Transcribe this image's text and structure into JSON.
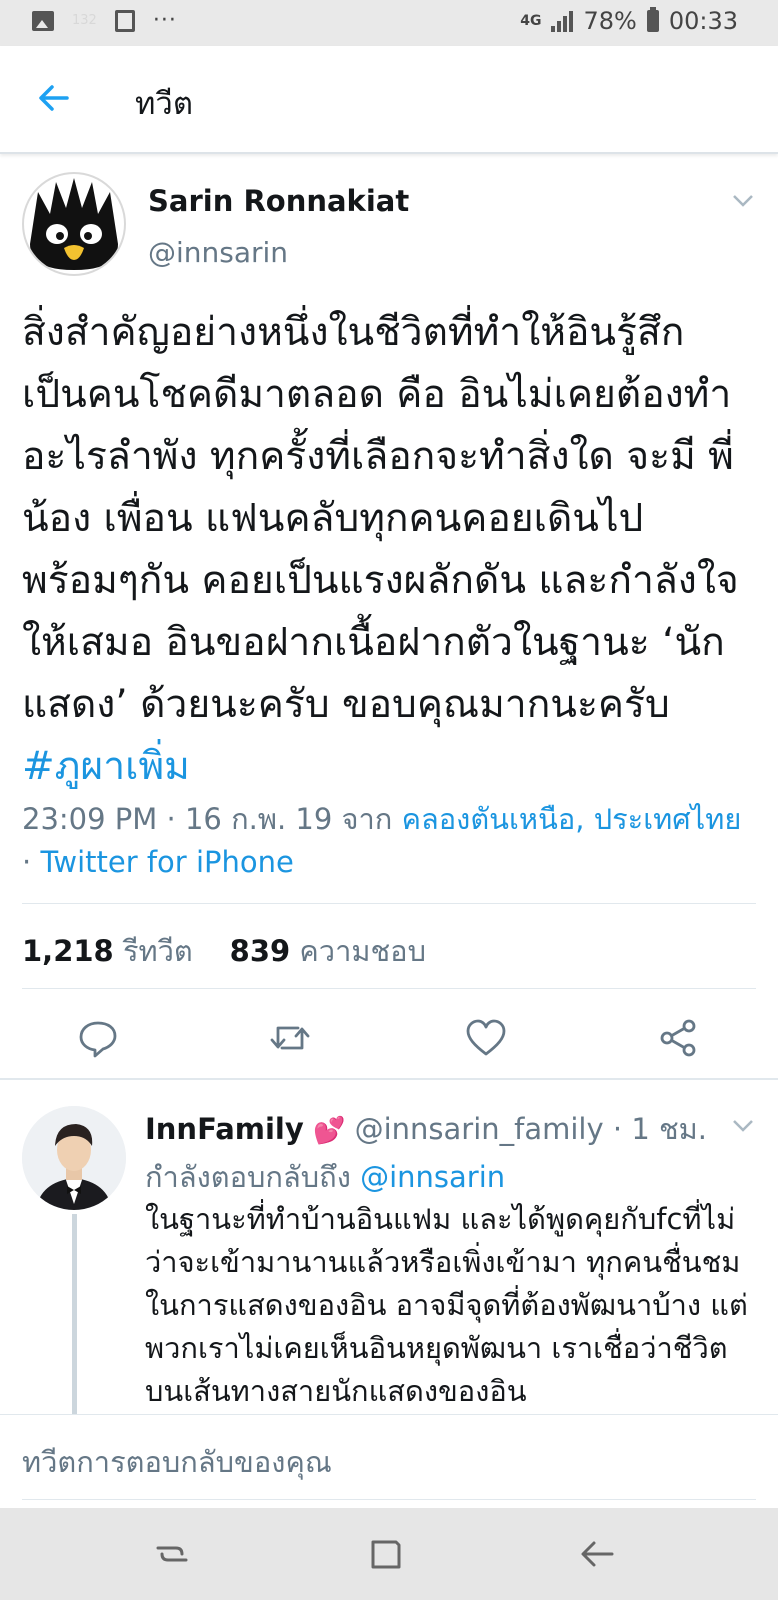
{
  "status_bar": {
    "notification_count": "132",
    "more": "···",
    "network": "4G",
    "battery": "78%",
    "time": "00:33",
    "icons": [
      "image-icon",
      "clipboard-icon",
      "signal-icon",
      "battery-icon"
    ]
  },
  "header": {
    "title": "ทวีต",
    "back_icon": "arrow-left-icon"
  },
  "tweet": {
    "author_name": "Sarin Ronnakiat",
    "author_handle": "@innsarin",
    "text": "สิ่งสำคัญอย่างหนึ่งในชีวิตที่ทำให้อินรู้สึก เป็นคนโชคดีมาตลอด คือ อินไม่เคยต้องทำอะไรลำพัง ทุกครั้งที่เลือกจะทำสิ่งใด จะมี พี่ น้อง เพื่อน แฟนคลับทุกคนคอยเดินไปพร้อมๆกัน คอยเป็นแรงผลักดัน และกำลังใจให้เสมอ อินขอฝากเนื้อฝากตัวในฐานะ ‘นักแสดง’ ด้วยนะครับ ขอบคุณมากนะครับ ",
    "hashtag": "#ภูผาเพิ่ม",
    "time": "23:09 PM · 16 ก.พ. 19 จาก ",
    "location": "คลองตันเหนือ, ประเทศไทย",
    "separator": " · ",
    "client": "Twitter for iPhone",
    "retweet_count": "1,218",
    "retweet_label": "รีทวีต",
    "like_count": "839",
    "like_label": "ความชอบ"
  },
  "actions": [
    "reply-icon",
    "retweet-icon",
    "heart-icon",
    "share-icon"
  ],
  "colors": {
    "link": "#1b95e0",
    "secondary_text": "#657786",
    "primary_text": "#14171a"
  },
  "reply": {
    "name": "InnFamily",
    "emoji": "💕",
    "handle": "@innsarin_family",
    "dot": " · ",
    "time": "1 ชม.",
    "replying_to_label": "กำลังตอบกลับถึง ",
    "replying_to_handle": "@innsarin",
    "text": "ในฐานะที่ทำบ้านอินแฟม และได้พูดคุยกับfcที่ไม่ว่าจะเข้ามานานแล้วหรือเพิ่งเข้ามา ทุกคนชื่นชมในการแสดงของอิน อาจมีจุดที่ต้องพัฒนาบ้าง แต่พวกเราไม่เคยเห็นอินหยุดพัฒนา เราเชื่อว่าชีวิตบนเส้นทางสายนักแสดงของอิน"
  },
  "compose": {
    "placeholder": "ทวีตการตอบกลับของคุณ"
  },
  "nav_bar": [
    "recent-apps-icon",
    "home-icon",
    "back-icon"
  ]
}
